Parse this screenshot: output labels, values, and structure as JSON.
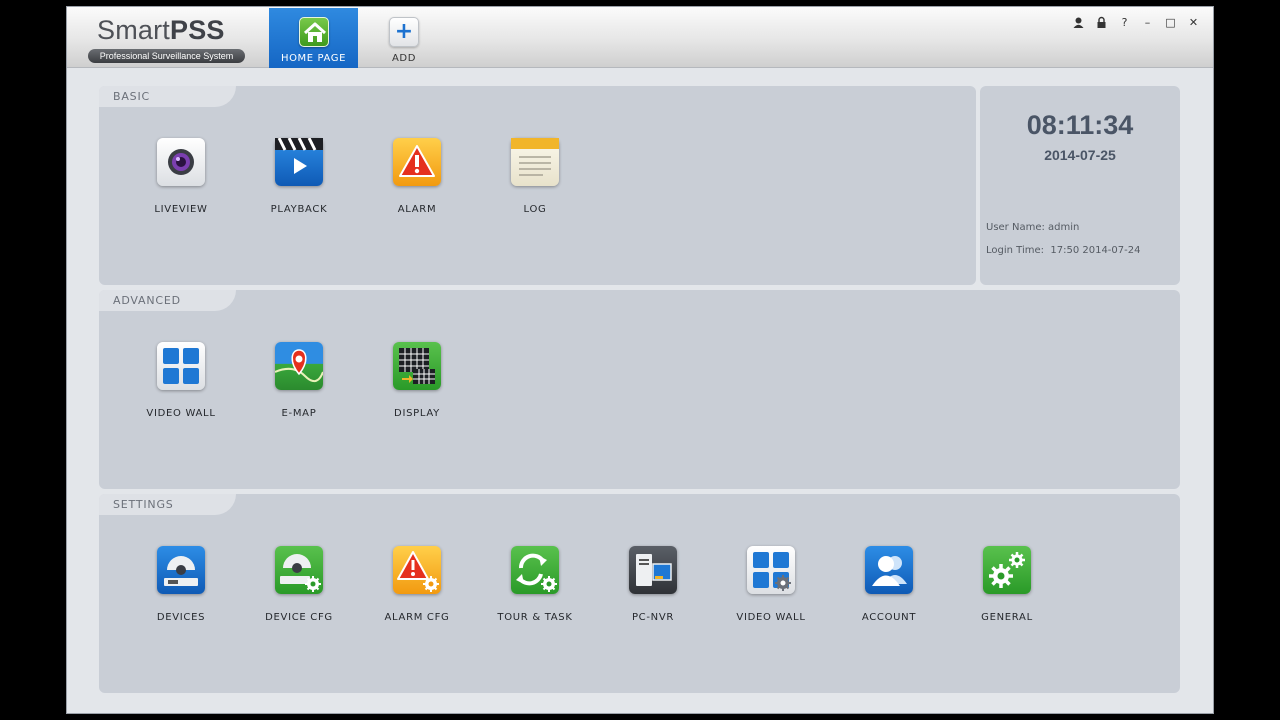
{
  "app": {
    "name_regular": "Smart",
    "name_bold": "PSS",
    "subtitle": "Professional Surveillance System"
  },
  "tabs": [
    {
      "label": "HOME PAGE",
      "icon": "home-icon",
      "active": true
    },
    {
      "label": "ADD",
      "icon": "plus-icon",
      "active": false
    }
  ],
  "add_glyph": "+",
  "window_controls": [
    "user-icon",
    "lock-icon",
    "help-icon",
    "minimize-icon",
    "maximize-icon",
    "close-icon"
  ],
  "window_glyphs": {
    "help": "?",
    "minimize": "–",
    "maximize": "□",
    "close": "✕"
  },
  "basic": {
    "title": "BASIC",
    "items": [
      {
        "label": "LIVEVIEW",
        "icon": "camera-lens-icon"
      },
      {
        "label": "PLAYBACK",
        "icon": "clapperboard-icon"
      },
      {
        "label": "ALARM",
        "icon": "warning-icon"
      },
      {
        "label": "LOG",
        "icon": "notepad-icon"
      }
    ]
  },
  "clock": {
    "time": "08:11:34",
    "date": "2014-07-25",
    "user_label": "User Name:",
    "user_value": "admin",
    "login_label": "Login Time:",
    "login_value": "17:50 2014-07-24"
  },
  "advanced": {
    "title": "ADVANCED",
    "items": [
      {
        "label": "VIDEO WALL",
        "icon": "video-wall-icon"
      },
      {
        "label": "E-MAP",
        "icon": "map-pin-icon"
      },
      {
        "label": "DISPLAY",
        "icon": "display-grid-icon"
      }
    ]
  },
  "settings": {
    "title": "SETTINGS",
    "items": [
      {
        "label": "DEVICES",
        "icon": "dome-camera-icon"
      },
      {
        "label": "DEVICE CFG",
        "icon": "dome-camera-gear-icon"
      },
      {
        "label": "ALARM CFG",
        "icon": "warning-gear-icon"
      },
      {
        "label": "TOUR & TASK",
        "icon": "refresh-gear-icon"
      },
      {
        "label": "PC-NVR",
        "icon": "nvr-icon"
      },
      {
        "label": "VIDEO WALL",
        "icon": "video-wall-gear-icon"
      },
      {
        "label": "ACCOUNT",
        "icon": "user-account-icon"
      },
      {
        "label": "GENERAL",
        "icon": "gears-icon"
      }
    ]
  },
  "colors": {
    "active_tab": "#1f78d4",
    "panel_bg": "#c9ced6",
    "panel_tab_bg": "#dee1e6",
    "clock_text": "#4a5566"
  }
}
